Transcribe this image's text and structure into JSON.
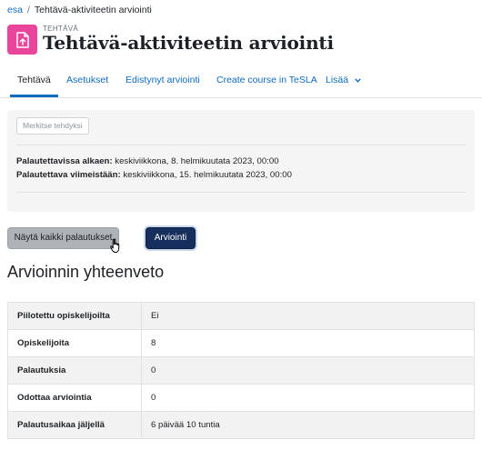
{
  "breadcrumb": {
    "parent": "esa",
    "separator": "/",
    "current": "Tehtävä-aktiviteetin arviointi"
  },
  "header": {
    "activity_type": "TEHTÄVÄ",
    "title": "Tehtävä-aktiviteetin arviointi",
    "icon": "assignment-upload-icon",
    "icon_color": "#e8459b"
  },
  "tabs": [
    {
      "label": "Tehtävä",
      "active": true
    },
    {
      "label": "Asetukset",
      "active": false
    },
    {
      "label": "Edistynyt arviointi",
      "active": false
    },
    {
      "label": "Create course in TeSLA",
      "active": false
    },
    {
      "label": "Lisää",
      "active": false,
      "icon": "chevron-down-icon"
    }
  ],
  "info": {
    "mark_done_label": "Merkitse tehdyksi",
    "opened_label": "Palautettavissa alkaen:",
    "opened_value": "keskiviikkona, 8. helmikuutata 2023, 00:00",
    "due_label": "Palautettava viimeistään:",
    "due_value": "keskiviikkona, 15. helmikuutata 2023, 00:00"
  },
  "actions": {
    "view_all_label": "Näytä kaikki palautukset",
    "grade_label": "Arviointi"
  },
  "summary": {
    "heading": "Arvioinnin yhteenveto",
    "rows": [
      {
        "label": "Piilotettu opiskelijoilta",
        "value": "Ei"
      },
      {
        "label": "Opiskelijoita",
        "value": "8"
      },
      {
        "label": "Palautuksia",
        "value": "0"
      },
      {
        "label": "Odottaa arviointia",
        "value": "0"
      },
      {
        "label": "Palautusaikaa jäljellä",
        "value": "6 päivää 10 tuntia"
      }
    ]
  },
  "colors": {
    "link": "#0f6cbf",
    "primary_button": "#162f5c",
    "secondary_button": "#aeb3b8"
  }
}
